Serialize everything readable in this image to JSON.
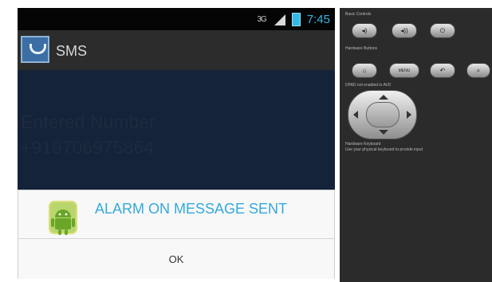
{
  "status_bar": {
    "network": "3G",
    "time": "7:45"
  },
  "action_bar": {
    "title": "SMS"
  },
  "main": {
    "entered_label": "Entered Number",
    "entered_number": "+919706975864"
  },
  "dialog": {
    "title": "ALARM ON MESSAGE SENT",
    "ok_label": "OK"
  },
  "emulator_panel": {
    "basic_controls_label": "Basic Controls",
    "hardware_buttons_label": "Hardware Buttons",
    "dpad_label": "DPAD not enabled in AVD",
    "keyboard_label": "Hardware Keyboard",
    "keyboard_hint": "Use your physical keyboard to provide input",
    "menu_label": "MENU",
    "icons": {
      "volume_down": "volume-down-icon",
      "volume_up": "volume-up-icon",
      "power": "power-icon",
      "home": "home-icon",
      "back": "back-icon",
      "search": "search-icon"
    }
  },
  "colors": {
    "accent": "#33b5e5",
    "dialog_title": "#33a9dc",
    "phone_background": "#14233a",
    "panel_background": "#2b2b2b"
  }
}
